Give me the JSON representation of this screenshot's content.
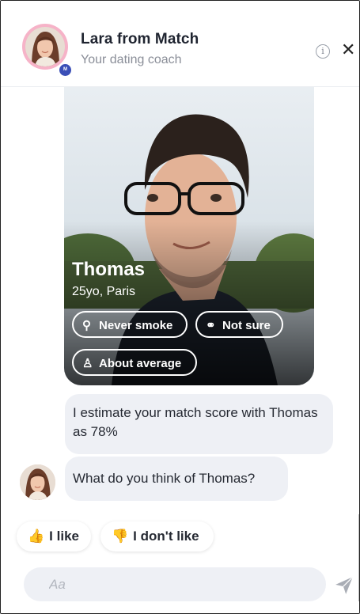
{
  "header": {
    "title": "Lara from Match",
    "subtitle": "Your dating coach",
    "badge_text": "M",
    "info_icon": "info-icon",
    "close_icon": "close-icon",
    "close_label": "✕"
  },
  "profile_card": {
    "name": "Thomas",
    "age_location": "25yo, Paris",
    "chips": [
      {
        "icon": "no-smoking-icon",
        "label": "Never smoke"
      },
      {
        "icon": "ring-icon",
        "label": "Not sure"
      },
      {
        "icon": "body-icon",
        "label": "About average"
      }
    ]
  },
  "messages": [
    {
      "from": "coach",
      "text": "I estimate your match score with Thomas as 78%"
    },
    {
      "from": "coach",
      "text": "What do you think of Thomas?"
    }
  ],
  "quick_replies": [
    {
      "emoji": "👍",
      "label": "I like"
    },
    {
      "emoji": "👎",
      "label": "I don't like"
    }
  ],
  "composer": {
    "placeholder": "Aa",
    "send_icon": "send-icon"
  },
  "colors": {
    "avatar_ring": "#f6b3c8",
    "bubble_bg": "#eef0f5",
    "badge": "#3a4fb7"
  }
}
